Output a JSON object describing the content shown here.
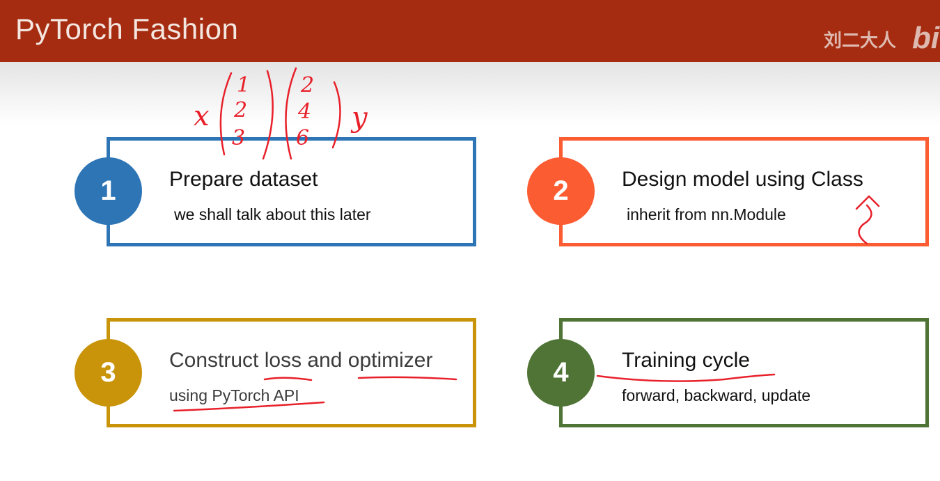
{
  "header": {
    "title": "PyTorch Fashion",
    "watermark": "刘二大人",
    "logo": "bili"
  },
  "colors": {
    "header_bg": "#a52c10",
    "step1": "#2e75b6",
    "step2": "#fc5c32",
    "step3": "#c9940a",
    "step4": "#4f7436",
    "annotation_ink": "#e8202a"
  },
  "steps": [
    {
      "number": "1",
      "title": "Prepare dataset",
      "subtitle": "we shall talk about this later"
    },
    {
      "number": "2",
      "title": "Design model using Class",
      "subtitle": "inherit from nn.Module"
    },
    {
      "number": "3",
      "title": "Construct loss and optimizer",
      "subtitle": "using PyTorch API"
    },
    {
      "number": "4",
      "title": "Training cycle",
      "subtitle": "forward, backward, update"
    }
  ],
  "annotations": {
    "x_label": "x",
    "y_label": "y",
    "x_values": [
      "1",
      "2",
      "3"
    ],
    "y_values": [
      "2",
      "4",
      "6"
    ]
  }
}
